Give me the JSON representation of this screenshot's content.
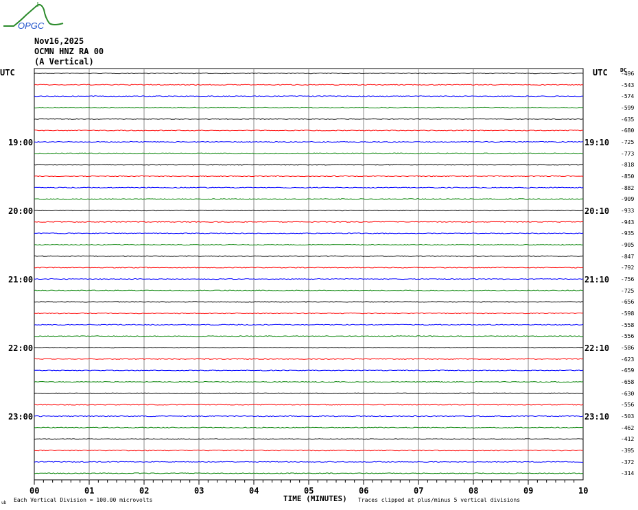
{
  "logo": {
    "text": "OPGC"
  },
  "header": {
    "date": "Nov16,2025",
    "station": "OCMN HNZ RA 00",
    "component": "(A Vertical)"
  },
  "chart_data": {
    "type": "line",
    "title": "Nov16,2025 OCMN HNZ RA 00 (A Vertical)",
    "xlabel": "TIME (MINUTES)",
    "x_ticks": [
      "00",
      "01",
      "02",
      "03",
      "04",
      "05",
      "06",
      "07",
      "08",
      "09",
      "10"
    ],
    "xlim": [
      0,
      10
    ],
    "left_axis_title": "UTC",
    "right_axis_title": "UTC",
    "dc_title": "DC",
    "left_labels": [
      {
        "trace": 6,
        "text": "19:00"
      },
      {
        "trace": 12,
        "text": "20:00"
      },
      {
        "trace": 18,
        "text": "21:00"
      },
      {
        "trace": 24,
        "text": "22:00"
      },
      {
        "trace": 30,
        "text": "23:00"
      }
    ],
    "right_labels": [
      {
        "trace": 6,
        "text": "19:10"
      },
      {
        "trace": 12,
        "text": "20:10"
      },
      {
        "trace": 18,
        "text": "21:10"
      },
      {
        "trace": 24,
        "text": "22:10"
      },
      {
        "trace": 30,
        "text": "23:10"
      }
    ],
    "trace_colors": [
      "#000000",
      "#ff0000",
      "#0000ff",
      "#008000"
    ],
    "trace_count": 36,
    "dc_offsets": [
      "-496",
      "-543",
      "-574",
      "-599",
      "-635",
      "-680",
      "-725",
      "-773",
      "-818",
      "-850",
      "-882",
      "-909",
      "-933",
      "-943",
      "-935",
      "-905",
      "-847",
      "-792",
      "-756",
      "-725",
      "-656",
      "-598",
      "-558",
      "-556",
      "-586",
      "-623",
      "-659",
      "-658",
      "-630",
      "-556",
      "-503",
      "-462",
      "-412",
      "-395",
      "-372",
      "-314"
    ],
    "footer_scale": "Each Vertical Division =  100.00 microvolts",
    "footer_clip": "Traces clipped at plus/minus 5 vertical divisions",
    "footer_mark": "ub"
  }
}
